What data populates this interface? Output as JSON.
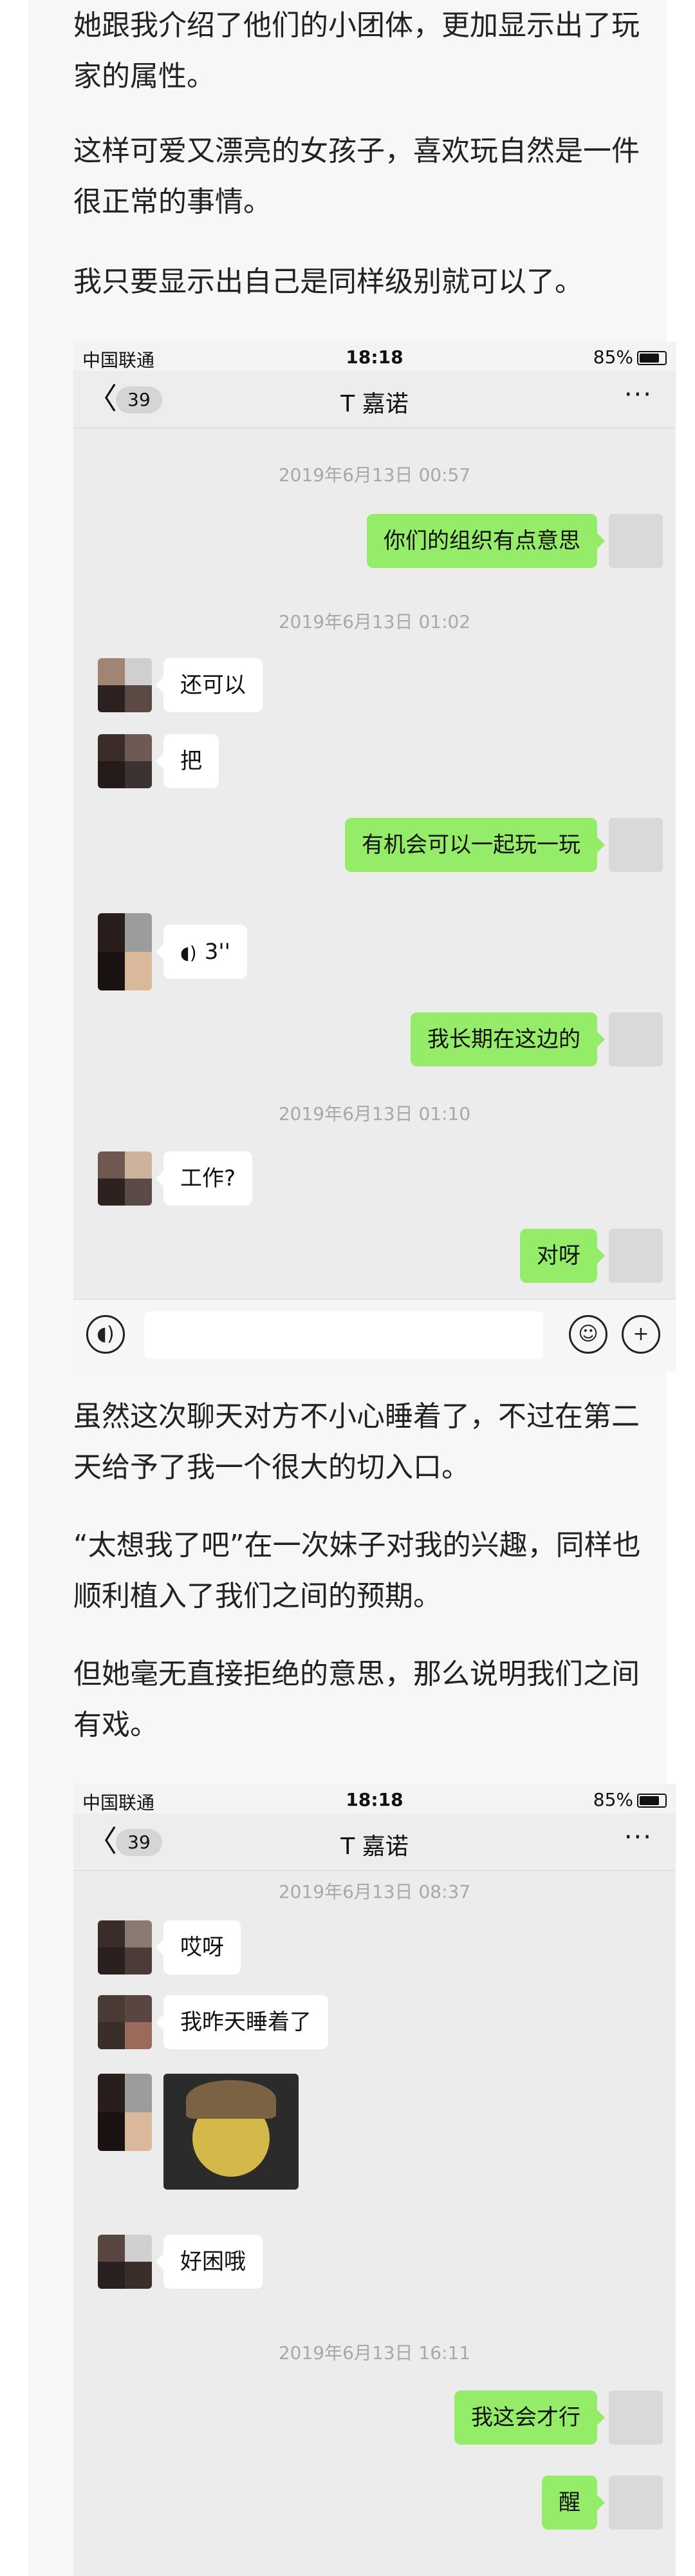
{
  "paragraphs": {
    "p1": "她跟我介绍了他们的小团体，更加显示出了玩家的属性。",
    "p2": "这样可爱又漂亮的女孩子，喜欢玩自然是一件很正常的事情。",
    "p3": "我只要显示出自己是同样级别就可以了。",
    "p4": "虽然这次聊天对方不小心睡着了，不过在第二天给予了我一个很大的切入口。",
    "p5": "“太想我了吧”在一次妹子对我的兴趣，同样也顺利植入了我们之间的预期。",
    "p6": "但她毫无直接拒绝的意思，那么说明我们之间有戏。"
  },
  "chat1": {
    "status": {
      "carrier": "中国联通",
      "time": "18:18",
      "battery": "85%"
    },
    "nav": {
      "back": "〈",
      "badge": "39",
      "title": "T 嘉诺",
      "more": "···"
    },
    "ts1": "2019年6月13日 00:57",
    "m1": "你们的组织有点意思",
    "ts2": "2019年6月13日 01:02",
    "m2": "还可以",
    "m3": "把",
    "m4": "有机会可以一起玩一玩",
    "m5_icon": "voice-icon",
    "m5": "3''",
    "m6": "我长期在这边的",
    "ts3": "2019年6月13日 01:10",
    "m7": "工作?",
    "m8": "对呀"
  },
  "chat2": {
    "status": {
      "carrier": "中国联通",
      "time": "18:18",
      "battery": "85%"
    },
    "nav": {
      "back": "〈",
      "badge": "39",
      "title": "T 嘉诺",
      "more": "···"
    },
    "ts1": "2019年6月13日 08:37",
    "m1": "哎呀",
    "m2": "我昨天睡着了",
    "m3": "好困哦",
    "ts2": "2019年6月13日 16:11",
    "m4": "我这会才行",
    "m5": "醒"
  },
  "colors": {
    "outgoing": "#95ec69",
    "incoming": "#ffffff",
    "chat_bg": "#ececec"
  }
}
